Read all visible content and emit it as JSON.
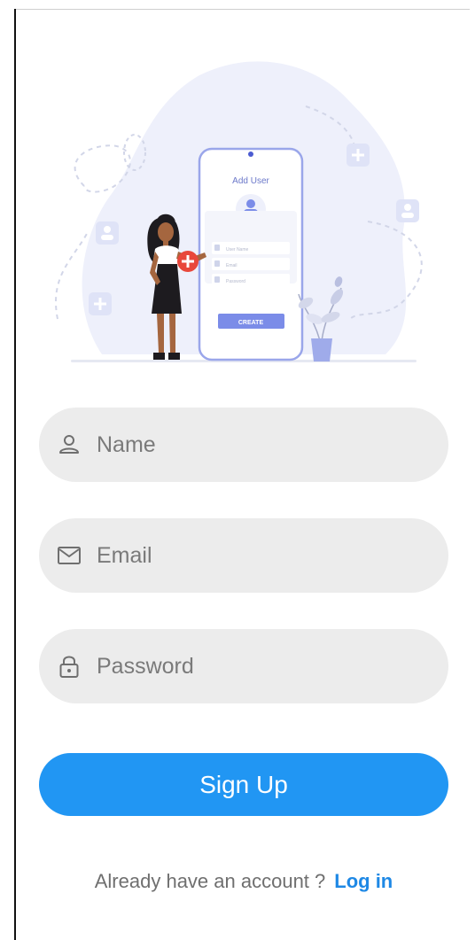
{
  "illustration": {
    "phone_title": "Add User",
    "field_labels": [
      "User Name",
      "Email",
      "Password"
    ],
    "button_label": "CREATE"
  },
  "form": {
    "name_placeholder": "Name",
    "email_placeholder": "Email",
    "password_placeholder": "Password"
  },
  "signup_button": "Sign Up",
  "footer": {
    "prompt": "Already have an account ?",
    "login_link": "Log in"
  },
  "colors": {
    "primary": "#2196f3",
    "link": "#1e88e5",
    "field_bg": "#ececec",
    "illustration_blob": "#eef0fb",
    "illustration_accent": "#7b8ce8",
    "badge_red": "#e8473b"
  },
  "icons": {
    "name": "user-icon",
    "email": "mail-icon",
    "password": "lock-icon"
  }
}
